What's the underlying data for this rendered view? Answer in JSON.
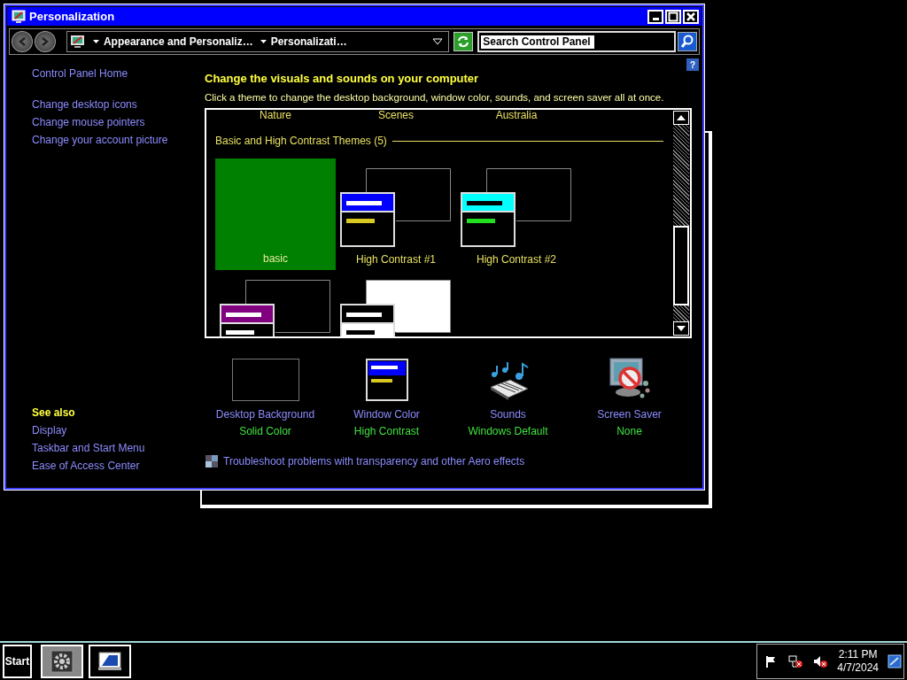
{
  "window": {
    "title": "Personalization"
  },
  "address_bar": {
    "breadcrumbs": [
      "Appearance and Personaliz…",
      "Personalizati…"
    ]
  },
  "search": {
    "value": "Search Control Panel"
  },
  "help_button": "?",
  "sidebar": {
    "home": "Control Panel Home",
    "tasks": [
      "Change desktop icons",
      "Change mouse pointers",
      "Change your account picture"
    ],
    "see_also_heading": "See also",
    "see_also": [
      "Display",
      "Taskbar and Start Menu",
      "Ease of Access Center"
    ]
  },
  "heading": "Change the visuals and sounds on your computer",
  "description": "Click a theme to change the desktop background, window color, sounds, and screen saver all at once.",
  "themes": {
    "top_labels": [
      "Nature",
      "Scenes",
      "Australia"
    ],
    "group_title": "Basic and High Contrast Themes (5)",
    "items": [
      {
        "label": "basic",
        "kind": "solid",
        "color": "#008000"
      },
      {
        "label": "High Contrast #1",
        "kind": "contrast",
        "preview": [
          {
            "kind": "desktop",
            "color": "#000000"
          },
          {
            "kind": "window",
            "color": "#000000"
          },
          {
            "kind": "title",
            "color": "#0000ff"
          },
          {
            "kind": "text",
            "color": "#ffffff"
          },
          {
            "kind": "line",
            "color": "#d8c820"
          }
        ]
      },
      {
        "label": "High Contrast #2",
        "kind": "contrast",
        "preview": [
          {
            "kind": "desktop",
            "color": "#000000"
          },
          {
            "kind": "window",
            "color": "#000000"
          },
          {
            "kind": "title",
            "color": "#00ffff"
          },
          {
            "kind": "text",
            "color": "#000000"
          },
          {
            "kind": "line",
            "color": "#20e020"
          }
        ]
      },
      {
        "kind": "contrast",
        "preview": [
          {
            "kind": "desktop",
            "color": "#000000"
          },
          {
            "kind": "window",
            "color": "#000000"
          },
          {
            "kind": "title",
            "color": "#800080"
          },
          {
            "kind": "text",
            "color": "#ffffff"
          },
          {
            "kind": "line",
            "color": "#ffffff"
          }
        ]
      },
      {
        "kind": "contrast",
        "preview": [
          {
            "kind": "desktop",
            "color": "#ffffff"
          },
          {
            "kind": "window",
            "color": "#ffffff"
          },
          {
            "kind": "title",
            "color": "#000000"
          },
          {
            "kind": "text",
            "color": "#ffffff"
          },
          {
            "kind": "line",
            "color": "#000000"
          }
        ]
      }
    ]
  },
  "settings": [
    {
      "kind": "background",
      "label": "Desktop Background",
      "value": "Solid Color"
    },
    {
      "kind": "window",
      "label": "Window Color",
      "value": "High Contrast"
    },
    {
      "kind": "sounds",
      "label": "Sounds",
      "value": "Windows Default"
    },
    {
      "kind": "screensaver",
      "label": "Screen Saver",
      "value": "None"
    }
  ],
  "troubleshoot_link": "Troubleshoot problems with transparency and other Aero effects",
  "taskbar": {
    "start": "Start",
    "tasks": [
      {
        "kind": "settings",
        "selected": true
      },
      {
        "kind": "display",
        "selected": false
      }
    ],
    "time": "2:11 PM",
    "date": "4/7/2024"
  }
}
